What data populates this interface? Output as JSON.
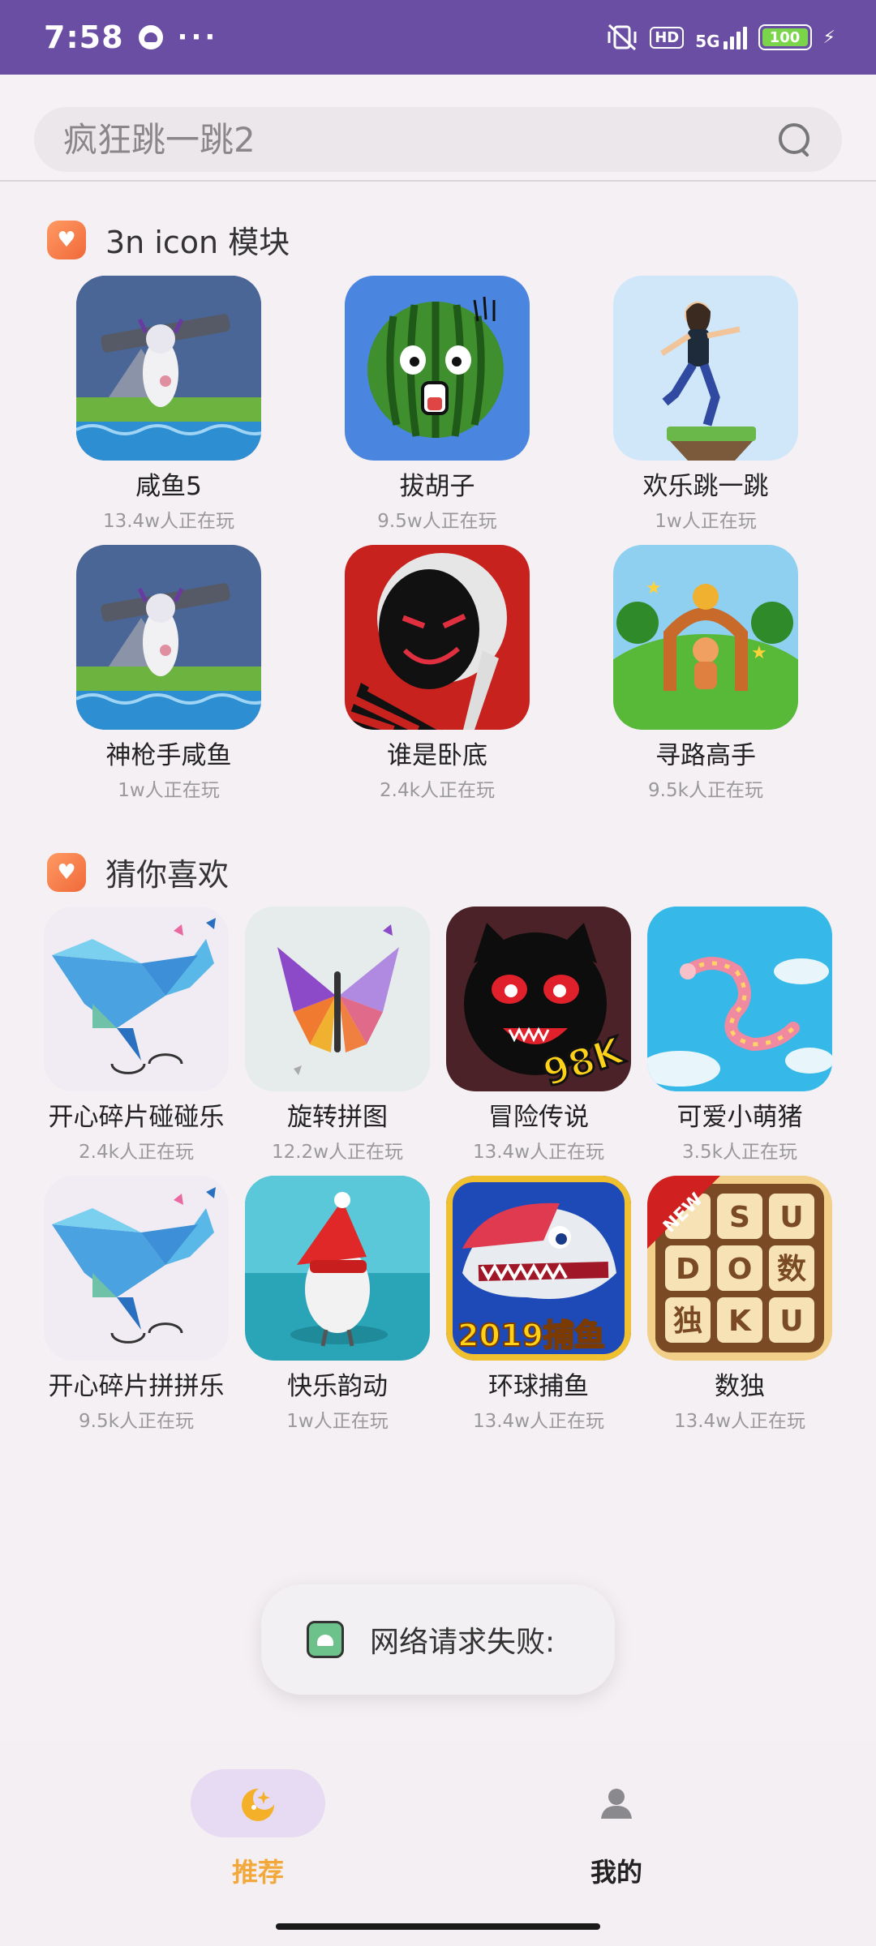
{
  "status_bar": {
    "time": "7:58",
    "more": "···",
    "hd": "HD",
    "network": "5G",
    "battery": "100"
  },
  "search": {
    "placeholder": "疯狂跳一跳2"
  },
  "section1": {
    "title": "3n icon 模块",
    "games": [
      {
        "name": "咸鱼5",
        "plays": "13.4w人正在玩"
      },
      {
        "name": "拔胡子",
        "plays": "9.5w人正在玩"
      },
      {
        "name": "欢乐跳一跳",
        "plays": "1w人正在玩"
      },
      {
        "name": "神枪手咸鱼",
        "plays": "1w人正在玩"
      },
      {
        "name": "谁是卧底",
        "plays": "2.4k人正在玩"
      },
      {
        "name": "寻路高手",
        "plays": "9.5k人正在玩"
      }
    ]
  },
  "section2": {
    "title": "猜你喜欢",
    "games": [
      {
        "name": "开心碎片碰碰乐",
        "plays": "2.4k人正在玩"
      },
      {
        "name": "旋转拼图",
        "plays": "12.2w人正在玩"
      },
      {
        "name": "冒险传说",
        "plays": "13.4w人正在玩"
      },
      {
        "name": "可爱小萌猪",
        "plays": "3.5k人正在玩"
      },
      {
        "name": "开心碎片拼拼乐",
        "plays": "9.5k人正在玩"
      },
      {
        "name": "快乐韵动",
        "plays": "1w人正在玩"
      },
      {
        "name": "环球捕鱼",
        "plays": "13.4w人正在玩"
      },
      {
        "name": "数独",
        "plays": "13.4w人正在玩"
      }
    ],
    "icon_texts": {
      "adventure_badge": "98K",
      "fishing_banner": "2019捕鱼",
      "sudoku_new": "NEW",
      "sudoku_cells": [
        "S",
        "U",
        "D",
        "O",
        "数",
        "独",
        "K",
        "U"
      ]
    }
  },
  "toast": {
    "text": "网络请求失败:"
  },
  "bottom_nav": {
    "recommend": "推荐",
    "mine": "我的"
  }
}
